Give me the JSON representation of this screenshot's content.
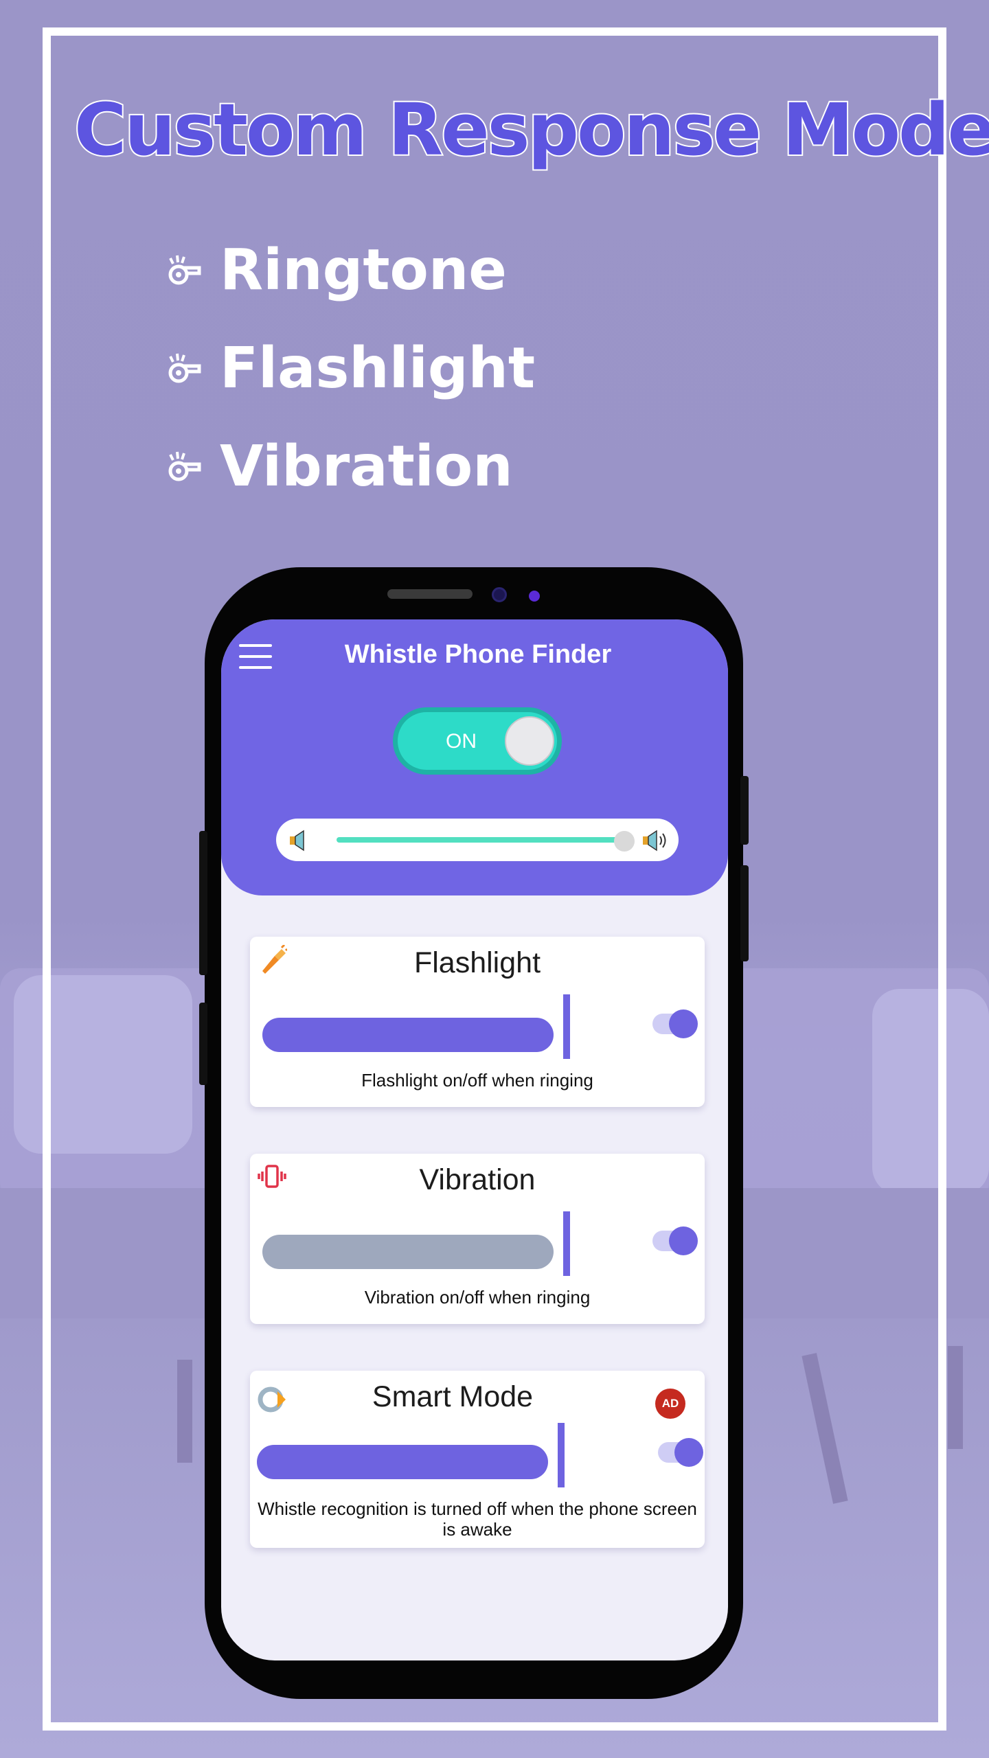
{
  "promo": {
    "headline": "Custom Response Mode",
    "features": [
      {
        "label": "Ringtone",
        "icon": "whistle-icon"
      },
      {
        "label": "Flashlight",
        "icon": "whistle-icon"
      },
      {
        "label": "Vibration",
        "icon": "whistle-icon"
      }
    ]
  },
  "app": {
    "title": "Whistle Phone Finder",
    "main_toggle": {
      "label": "ON",
      "state": "on"
    },
    "volume": {
      "level": 0.96
    }
  },
  "cards": [
    {
      "title": "Flashlight",
      "description": "Flashlight on/off when ringing",
      "icon": "flashlight-icon",
      "enabled": true
    },
    {
      "title": "Vibration",
      "description": "Vibration on/off when ringing",
      "icon": "vibration-icon",
      "enabled": true
    },
    {
      "title": "Smart Mode",
      "description": "Whistle recognition is turned off when the phone screen is awake",
      "icon": "smart-mode-icon",
      "badge": "AD",
      "enabled": true
    }
  ],
  "colors": {
    "accent": "#7065e4",
    "headline": "#5d55e0",
    "toggle_on": "#2ddbc8",
    "volume_track": "#52dfc0",
    "ad_badge": "#c52a1f"
  }
}
